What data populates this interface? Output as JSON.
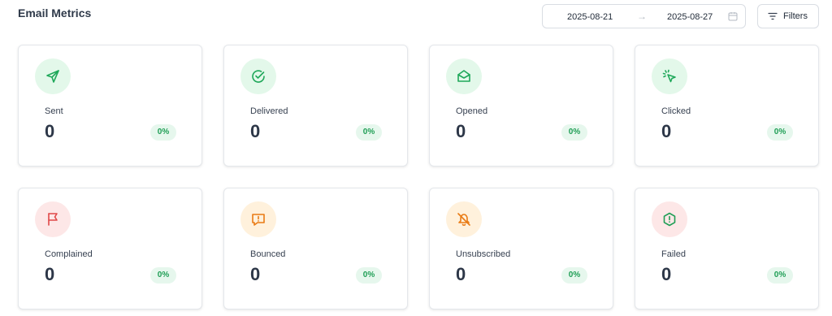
{
  "header": {
    "title": "Email Metrics",
    "date_from": "2025-08-21",
    "date_arrow": "→",
    "date_to": "2025-08-27",
    "filters_label": "Filters"
  },
  "metrics": [
    {
      "label": "Sent",
      "value": "0",
      "pct": "0%",
      "icon": "send-icon",
      "tone": "green"
    },
    {
      "label": "Delivered",
      "value": "0",
      "pct": "0%",
      "icon": "check-circle-icon",
      "tone": "green"
    },
    {
      "label": "Opened",
      "value": "0",
      "pct": "0%",
      "icon": "mail-open-icon",
      "tone": "green"
    },
    {
      "label": "Clicked",
      "value": "0",
      "pct": "0%",
      "icon": "pointer-click-icon",
      "tone": "green"
    },
    {
      "label": "Complained",
      "value": "0",
      "pct": "0%",
      "icon": "flag-icon",
      "tone": "red"
    },
    {
      "label": "Bounced",
      "value": "0",
      "pct": "0%",
      "icon": "message-alert-icon",
      "tone": "orange"
    },
    {
      "label": "Unsubscribed",
      "value": "0",
      "pct": "0%",
      "icon": "bell-off-icon",
      "tone": "orange"
    },
    {
      "label": "Failed",
      "value": "0",
      "pct": "0%",
      "icon": "alert-hexagon-icon",
      "tone": "red"
    }
  ],
  "colors": {
    "green_bg": "#e3f8ea",
    "green_fg": "#1fa85a",
    "red_bg": "#fde7e7",
    "red_fg": "#e04848",
    "orange_bg": "#fff1dc",
    "orange_fg": "#e97b14",
    "badge_bg": "#e6f7ed",
    "badge_fg": "#1f9e55"
  }
}
